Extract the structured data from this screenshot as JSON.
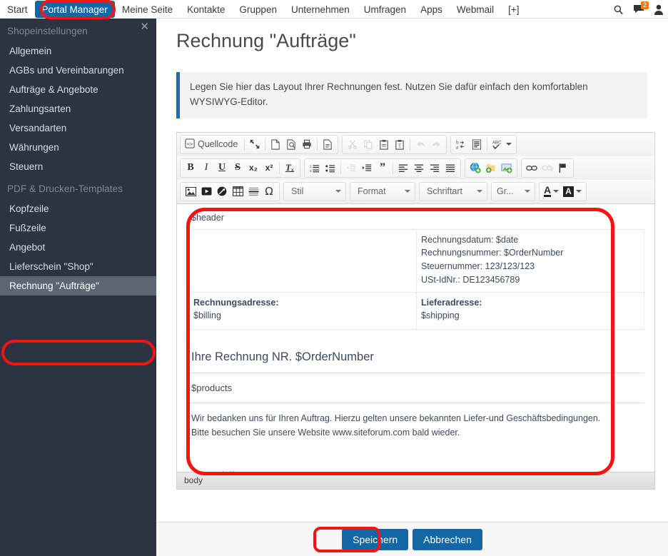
{
  "topnav": {
    "items": [
      {
        "label": "Start",
        "active": false
      },
      {
        "label": "Portal Manager",
        "active": true
      },
      {
        "label": "Meine Seite",
        "active": false
      },
      {
        "label": "Kontakte",
        "active": false
      },
      {
        "label": "Gruppen",
        "active": false
      },
      {
        "label": "Unternehmen",
        "active": false
      },
      {
        "label": "Umfragen",
        "active": false
      },
      {
        "label": "Apps",
        "active": false
      },
      {
        "label": "Webmail",
        "active": false
      },
      {
        "label": "[+]",
        "active": false
      }
    ],
    "right": {
      "search_icon": "search-icon",
      "messages_icon": "messages-icon",
      "messages_badge": "2",
      "account_icon": "user-account-icon"
    },
    "active_color": "#1268a5",
    "highlight_color": "#f41414"
  },
  "sidebar": {
    "close_label": "✕",
    "groups": [
      {
        "title": "Shopeinstellungen",
        "items": [
          {
            "label": "Allgemein",
            "selected": false
          },
          {
            "label": "AGBs und Vereinbarungen",
            "selected": false
          },
          {
            "label": "Aufträge & Angebote",
            "selected": false
          },
          {
            "label": "Zahlungsarten",
            "selected": false
          },
          {
            "label": "Versandarten",
            "selected": false
          },
          {
            "label": "Währungen",
            "selected": false
          },
          {
            "label": "Steuern",
            "selected": false
          }
        ]
      },
      {
        "title": "PDF & Drucken-Templates",
        "items": [
          {
            "label": "Kopfzeile",
            "selected": false
          },
          {
            "label": "Fußzeile",
            "selected": false
          },
          {
            "label": "Angebot",
            "selected": false
          },
          {
            "label": "Lieferschein \"Shop\"",
            "selected": false
          },
          {
            "label": "Rechnung \"Aufträge\"",
            "selected": true
          }
        ]
      }
    ],
    "background": "#2b3440",
    "selected_background": "#5b6672"
  },
  "main": {
    "page_title": "Rechnung \"Aufträge\"",
    "infobox": "Legen Sie hier das Layout Ihrer Rechnungen fest. Nutzen Sie dafür einfach den komfortablen WYSIWYG-Editor.",
    "infobox_accent": "#1a6fa8"
  },
  "editor": {
    "toolbar_row1": [
      {
        "group": 1,
        "name": "source-code-button",
        "label": "Quellcode",
        "icon": "source-code-icon",
        "type": "text",
        "disabled": false
      },
      {
        "group": 1,
        "name": "separator",
        "type": "sep"
      },
      {
        "group": 1,
        "name": "maximize-button",
        "icon": "maximize-icon",
        "type": "icon",
        "disabled": false
      },
      {
        "group": 1,
        "name": "separator",
        "type": "sep"
      },
      {
        "group": 1,
        "name": "new-page-button",
        "icon": "new-page-icon",
        "type": "icon",
        "disabled": false
      },
      {
        "group": 1,
        "name": "preview-button",
        "icon": "preview-icon",
        "type": "icon",
        "disabled": false
      },
      {
        "group": 1,
        "name": "print-button",
        "icon": "print-icon",
        "type": "icon",
        "disabled": false
      },
      {
        "group": 1,
        "name": "separator",
        "type": "sep"
      },
      {
        "group": 1,
        "name": "templates-button",
        "icon": "templates-icon",
        "type": "icon",
        "disabled": false
      },
      {
        "group": 2,
        "name": "cut-button",
        "icon": "scissors-icon",
        "type": "icon",
        "disabled": true
      },
      {
        "group": 2,
        "name": "copy-button",
        "icon": "copy-icon",
        "type": "icon",
        "disabled": true
      },
      {
        "group": 2,
        "name": "paste-button",
        "icon": "paste-icon",
        "type": "icon",
        "disabled": false
      },
      {
        "group": 2,
        "name": "paste-as-text-button",
        "icon": "paste-text-icon",
        "type": "icon",
        "disabled": false
      },
      {
        "group": 2,
        "name": "separator",
        "type": "sep"
      },
      {
        "group": 2,
        "name": "undo-button",
        "icon": "undo-arrow-icon",
        "type": "icon",
        "disabled": true
      },
      {
        "group": 2,
        "name": "redo-button",
        "icon": "redo-arrow-icon",
        "type": "icon",
        "disabled": true
      },
      {
        "group": 3,
        "name": "replace-button",
        "icon": "find-replace-icon",
        "type": "icon",
        "disabled": false
      },
      {
        "group": 3,
        "name": "select-all-button",
        "icon": "select-all-icon",
        "type": "icon",
        "disabled": false
      },
      {
        "group": 3,
        "name": "separator",
        "type": "sep"
      },
      {
        "group": 3,
        "name": "spellcheck-button",
        "icon": "spellcheck-abc-icon",
        "type": "icon-caret",
        "disabled": false
      }
    ],
    "toolbar_row2": [
      {
        "group": 1,
        "name": "bold-button",
        "icon": "bold-icon",
        "glyph": "B",
        "disabled": false
      },
      {
        "group": 1,
        "name": "italic-button",
        "icon": "italic-icon",
        "glyph": "I",
        "disabled": false
      },
      {
        "group": 1,
        "name": "underline-button",
        "icon": "underline-icon",
        "glyph": "U",
        "disabled": false
      },
      {
        "group": 1,
        "name": "strikethrough-button",
        "icon": "strikethrough-icon",
        "glyph": "S",
        "disabled": false
      },
      {
        "group": 1,
        "name": "subscript-button",
        "icon": "subscript-icon",
        "glyph": "x₂",
        "disabled": false
      },
      {
        "group": 1,
        "name": "superscript-button",
        "icon": "superscript-icon",
        "glyph": "x²",
        "disabled": false
      },
      {
        "group": 1,
        "name": "separator",
        "type": "sep"
      },
      {
        "group": 1,
        "name": "remove-format-button",
        "icon": "remove-format-icon",
        "glyph": "Tₓ",
        "disabled": false
      },
      {
        "group": 2,
        "name": "numbered-list-button",
        "icon": "numbered-list-icon",
        "disabled": false
      },
      {
        "group": 2,
        "name": "bulleted-list-button",
        "icon": "bulleted-list-icon",
        "disabled": false
      },
      {
        "group": 2,
        "name": "separator",
        "type": "sep"
      },
      {
        "group": 2,
        "name": "decrease-indent-button",
        "icon": "decrease-indent-icon",
        "disabled": true
      },
      {
        "group": 2,
        "name": "increase-indent-button",
        "icon": "increase-indent-icon",
        "disabled": false
      },
      {
        "group": 2,
        "name": "blockquote-button",
        "icon": "blockquote-icon",
        "disabled": false
      },
      {
        "group": 2,
        "name": "separator",
        "type": "sep"
      },
      {
        "group": 2,
        "name": "align-left-button",
        "icon": "align-left-icon",
        "disabled": false
      },
      {
        "group": 2,
        "name": "align-center-button",
        "icon": "align-center-icon",
        "disabled": false
      },
      {
        "group": 2,
        "name": "align-right-button",
        "icon": "align-right-icon",
        "disabled": false
      },
      {
        "group": 2,
        "name": "align-justify-button",
        "icon": "align-justify-icon",
        "disabled": false
      },
      {
        "group": 3,
        "name": "insert-internal-link-button",
        "icon": "globe-add-icon",
        "disabled": false
      },
      {
        "group": 3,
        "name": "insert-file-button",
        "icon": "folder-add-icon",
        "disabled": false
      },
      {
        "group": 3,
        "name": "insert-image-button",
        "icon": "image-add-icon",
        "disabled": false
      },
      {
        "group": 4,
        "name": "link-button",
        "icon": "link-chain-icon",
        "disabled": false
      },
      {
        "group": 4,
        "name": "unlink-button",
        "icon": "unlink-chain-icon",
        "disabled": true
      },
      {
        "group": 4,
        "name": "anchor-button",
        "icon": "flag-anchor-icon",
        "disabled": false
      }
    ],
    "toolbar_row3": [
      {
        "group": 1,
        "name": "image-button",
        "icon": "picture-icon",
        "disabled": false
      },
      {
        "group": 1,
        "name": "video-button",
        "icon": "video-play-icon",
        "disabled": false
      },
      {
        "group": 1,
        "name": "flash-button",
        "icon": "flash-icon",
        "disabled": false
      },
      {
        "group": 1,
        "name": "table-button",
        "icon": "table-grid-icon",
        "disabled": false
      },
      {
        "group": 1,
        "name": "horizontal-rule-button",
        "icon": "horizontal-rule-icon",
        "disabled": false
      },
      {
        "group": 1,
        "name": "special-char-button",
        "icon": "omega-special-char-icon",
        "glyph": "Ω",
        "disabled": false
      }
    ],
    "combos": [
      {
        "name": "style-select",
        "label": "Stil"
      },
      {
        "name": "format-select",
        "label": "Format"
      },
      {
        "name": "font-select",
        "label": "Schriftart"
      },
      {
        "name": "size-select",
        "label": "Gr..."
      }
    ],
    "color_buttons": [
      {
        "name": "text-color-button",
        "icon": "text-color-a-icon",
        "glyph": "A"
      },
      {
        "name": "background-color-button",
        "icon": "bg-color-a-icon",
        "glyph": "A"
      }
    ],
    "statusbar": "body",
    "highlight_color": "#f41414"
  },
  "document": {
    "header_placeholder": "$header",
    "meta_lines": [
      "Rechnungsdatum: $date",
      "Rechnungsnummer: $OrderNumber",
      "Steuernummer: 123/123/123",
      "USt-IdNr.: DE123456789"
    ],
    "billing_label": "Rechnungsadresse:",
    "billing_value": "$billing",
    "shipping_label": "Lieferadresse:",
    "shipping_value": "$shipping",
    "heading": "Ihre Rechnung NR. $OrderNumber",
    "products_placeholder": "$products",
    "thanks_line1": "Wir bedanken uns für Ihren Auftrag. Hierzu gelten unsere bekannten Liefer-und Geschäftsbedingungen.",
    "thanks_line2": "Bitte besuchen Sie unsere Website www.siteforum.com bald wieder.",
    "signature": "Unterschrift"
  },
  "footer": {
    "save_label": "Speichern",
    "cancel_label": "Abbrechen",
    "button_color": "#1268a5",
    "highlight_color": "#f41414"
  }
}
